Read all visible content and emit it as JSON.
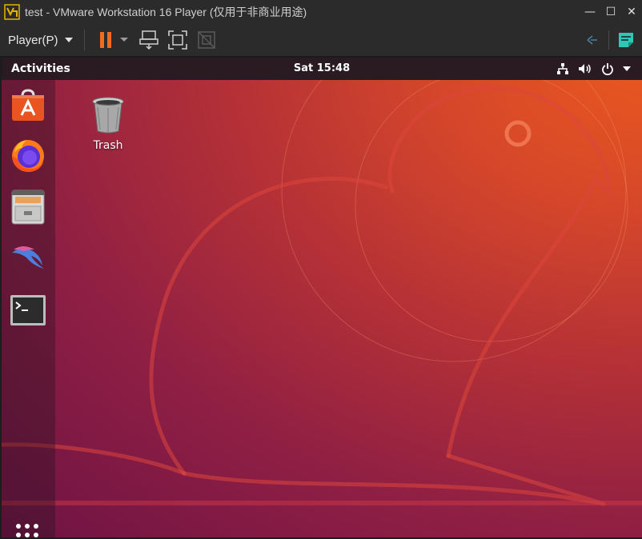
{
  "window": {
    "title": "test - VMware Workstation 16 Player (仅用于非商业用途)",
    "minimize_glyph": "—",
    "maximize_glyph": "☐",
    "close_glyph": "✕"
  },
  "toolbar": {
    "player_menu_label": "Player(P)",
    "pause_color": "#f26b21",
    "icons": [
      "pause-icon",
      "dropdown-caret-icon",
      "send-ctrl-alt-del-icon",
      "full-screen-icon",
      "unity-icon",
      "network-back-icon",
      "message-notes-icon"
    ]
  },
  "ubuntu": {
    "topbar": {
      "activities_label": "Activities",
      "clock": "Sat 15:48",
      "tray_icons": [
        "network-icon",
        "volume-icon",
        "power-icon",
        "system-menu-caret-icon"
      ]
    },
    "dock": {
      "items": [
        "ubuntu-software-icon",
        "firefox-icon",
        "files-icon",
        "kali-icon",
        "terminal-icon"
      ],
      "apps_grid_icon": "show-applications-icon"
    },
    "desktop": {
      "icons": [
        {
          "name": "trash-icon",
          "label": "Trash"
        }
      ]
    },
    "colors": {
      "accent_orange": "#e95420",
      "aubergine": "#77216f"
    }
  }
}
